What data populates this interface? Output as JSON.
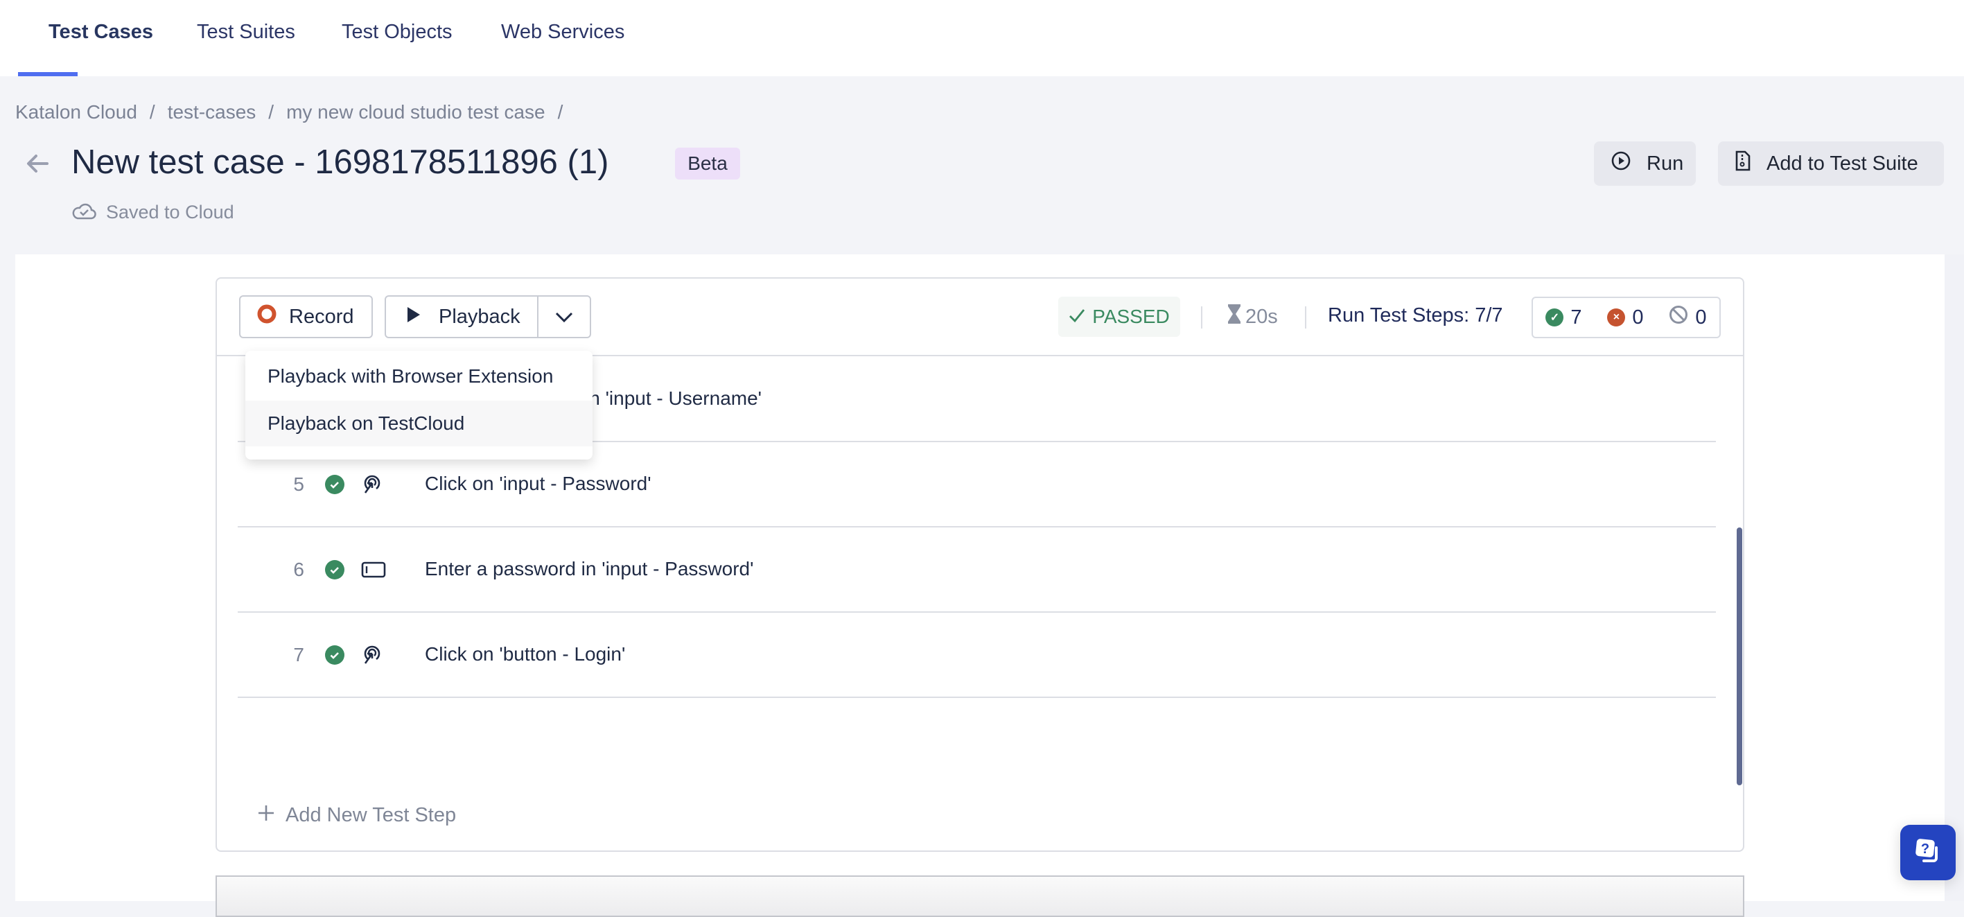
{
  "nav": {
    "tabs": [
      {
        "label": "Test Cases",
        "active": true
      },
      {
        "label": "Test Suites"
      },
      {
        "label": "Test Objects"
      },
      {
        "label": "Web Services"
      }
    ]
  },
  "breadcrumb": [
    "Katalon Cloud",
    "test-cases",
    "my new cloud studio test case"
  ],
  "breadcrumb_sep": "/",
  "header": {
    "title": "New test case - 1698178511896 (1)",
    "badge": "Beta",
    "saved_status": "Saved to Cloud",
    "run_label": "Run",
    "add_suite_label": "Add to Test Suite"
  },
  "toolbar": {
    "record_label": "Record",
    "playback_label": "Playback",
    "status": "PASSED",
    "duration": "20s",
    "run_steps": "Run Test Steps: 7/7",
    "passed_count": "7",
    "failed_count": "0",
    "skipped_count": "0"
  },
  "playback_menu": [
    "Playback with Browser Extension",
    "Playback on TestCloud"
  ],
  "steps": [
    {
      "num": "",
      "text": "in 'input - Username'",
      "status": "passed",
      "action_icon": "input-icon"
    },
    {
      "num": "5",
      "text": "Click on 'input - Password'",
      "status": "passed",
      "action_icon": "click-icon"
    },
    {
      "num": "6",
      "text": "Enter a password in 'input - Password'",
      "status": "passed",
      "action_icon": "input-icon"
    },
    {
      "num": "7",
      "text": "Click on 'button - Login'",
      "status": "passed",
      "action_icon": "click-icon"
    }
  ],
  "add_step_label": "Add New Test Step",
  "colors": {
    "accent": "#4f6ef0",
    "passed": "#3a8a60",
    "failed": "#c5532f",
    "record": "#d0532e",
    "help": "#2444c0"
  }
}
